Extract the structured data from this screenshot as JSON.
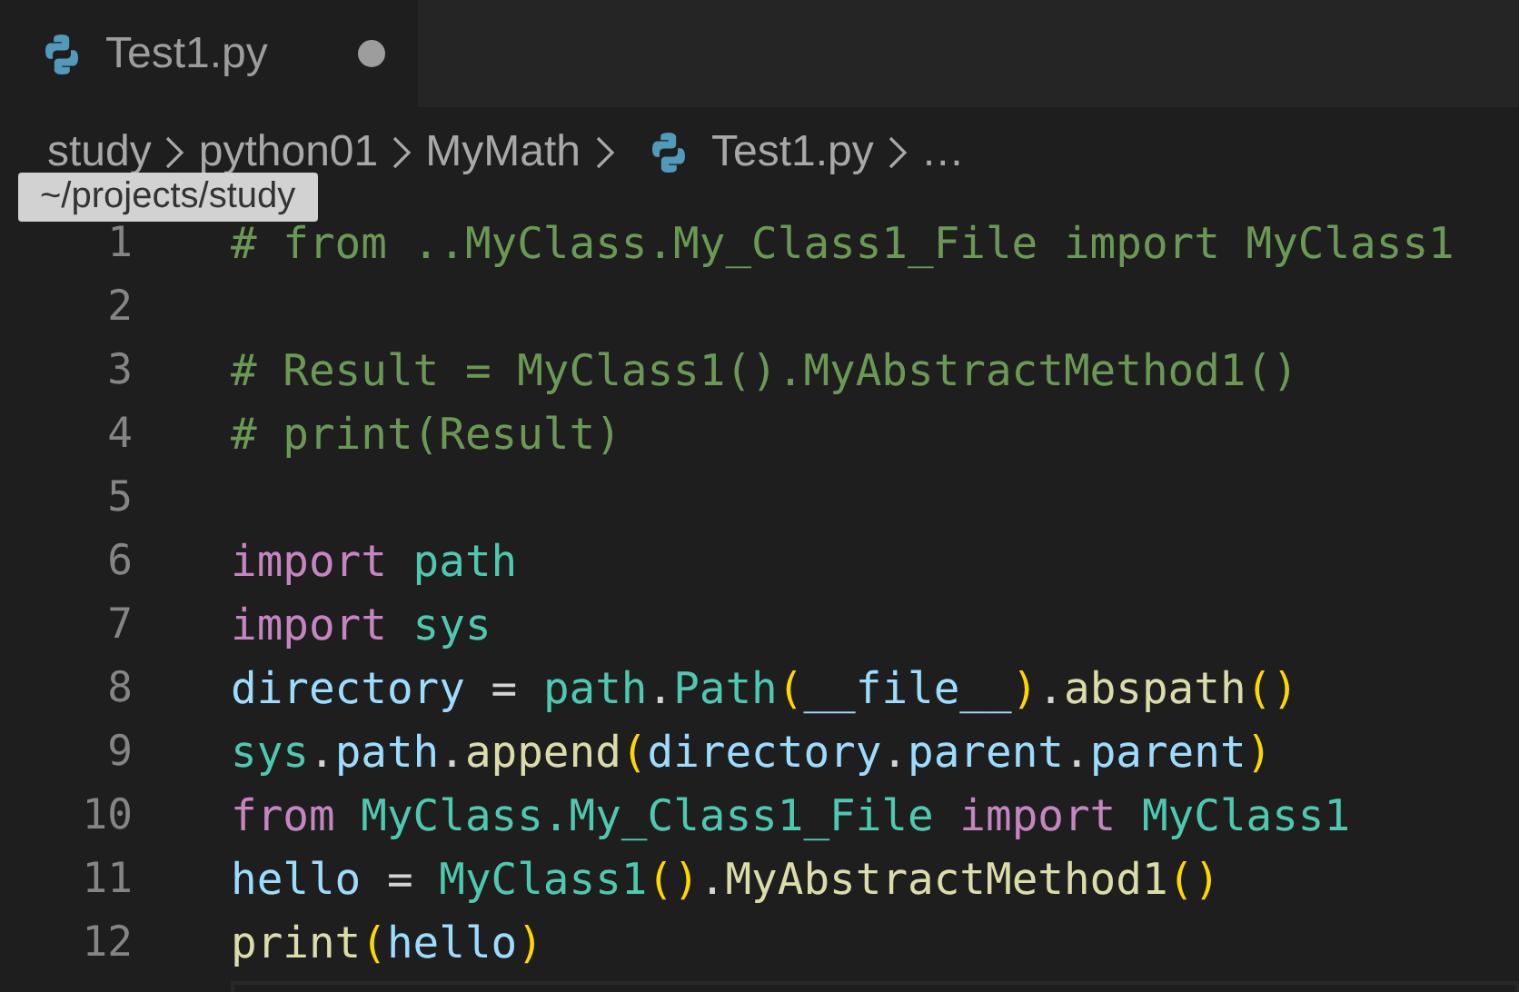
{
  "tabs": [
    {
      "label": "Test1.py",
      "selected": true,
      "modified": true
    }
  ],
  "breadcrumb": [
    {
      "kind": "folder",
      "label": "study"
    },
    {
      "kind": "folder",
      "label": "python01"
    },
    {
      "kind": "folder",
      "label": "MyMath"
    },
    {
      "kind": "file",
      "label": "Test1.py"
    },
    {
      "kind": "more",
      "label": "…"
    }
  ],
  "tooltip": "~/projects/study",
  "lines": [
    {
      "number": "1",
      "tokens": [
        {
          "kind": "comment",
          "text": "# from ..MyClass.My_Class1_File import MyClass1"
        }
      ]
    },
    {
      "number": "2"
    },
    {
      "number": "3",
      "tokens": [
        {
          "kind": "comment",
          "text": "# Result = MyClass1().MyAbstractMethod1()"
        }
      ]
    },
    {
      "number": "4",
      "tokens": [
        {
          "kind": "comment",
          "text": "# print(Result)"
        }
      ]
    },
    {
      "number": "5"
    },
    {
      "number": "6",
      "tokens": [
        {
          "kind": "keyword",
          "text": "import "
        },
        {
          "kind": "module",
          "text": "path"
        }
      ]
    },
    {
      "number": "7",
      "tokens": [
        {
          "kind": "keyword",
          "text": "import "
        },
        {
          "kind": "module",
          "text": "sys"
        }
      ]
    },
    {
      "number": "8",
      "tokens": [
        {
          "kind": "variable",
          "text": "directory"
        },
        {
          "kind": "plain",
          "text": " = "
        },
        {
          "kind": "module",
          "text": "path"
        },
        {
          "kind": "plain",
          "text": "."
        },
        {
          "kind": "module",
          "text": "Path"
        },
        {
          "kind": "paren",
          "text": "("
        },
        {
          "kind": "variable",
          "text": "__file__"
        },
        {
          "kind": "paren",
          "text": ")"
        },
        {
          "kind": "plain",
          "text": "."
        },
        {
          "kind": "function",
          "text": "abspath"
        },
        {
          "kind": "paren",
          "text": "()"
        }
      ]
    },
    {
      "number": "9",
      "tokens": [
        {
          "kind": "module",
          "text": "sys"
        },
        {
          "kind": "plain",
          "text": "."
        },
        {
          "kind": "variable",
          "text": "path"
        },
        {
          "kind": "plain",
          "text": "."
        },
        {
          "kind": "function",
          "text": "append"
        },
        {
          "kind": "paren",
          "text": "("
        },
        {
          "kind": "variable",
          "text": "directory"
        },
        {
          "kind": "plain",
          "text": "."
        },
        {
          "kind": "variable",
          "text": "parent"
        },
        {
          "kind": "plain",
          "text": "."
        },
        {
          "kind": "variable",
          "text": "parent"
        },
        {
          "kind": "paren",
          "text": ")"
        }
      ]
    },
    {
      "number": "10",
      "tokens": [
        {
          "kind": "keyword",
          "text": "from "
        },
        {
          "kind": "module",
          "text": "MyClass.My_Class1_File"
        },
        {
          "kind": "keyword",
          "text": " import "
        },
        {
          "kind": "module",
          "text": "MyClass1"
        }
      ]
    },
    {
      "number": "11",
      "tokens": [
        {
          "kind": "variable",
          "text": "hello"
        },
        {
          "kind": "plain",
          "text": " = "
        },
        {
          "kind": "module",
          "text": "MyClass1"
        },
        {
          "kind": "paren",
          "text": "()"
        },
        {
          "kind": "plain",
          "text": "."
        },
        {
          "kind": "function",
          "text": "MyAbstractMethod1"
        },
        {
          "kind": "paren",
          "text": "()"
        }
      ]
    },
    {
      "number": "12",
      "tokens": [
        {
          "kind": "function",
          "text": "print"
        },
        {
          "kind": "paren",
          "text": "("
        },
        {
          "kind": "variable",
          "text": "hello"
        },
        {
          "kind": "paren",
          "text": ")"
        }
      ]
    }
  ]
}
